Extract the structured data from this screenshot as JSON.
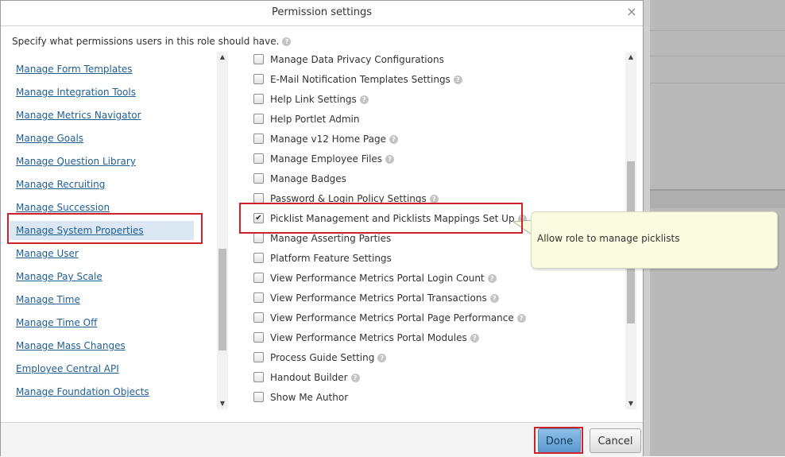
{
  "dialog": {
    "title": "Permission settings",
    "close_symbol": "×",
    "instruction": "Specify what permissions users in this role should have."
  },
  "left_nav": {
    "items": [
      {
        "label": "Manage Form Templates",
        "selected": false
      },
      {
        "label": "Manage Integration Tools",
        "selected": false
      },
      {
        "label": "Manage Metrics Navigator",
        "selected": false
      },
      {
        "label": "Manage Goals",
        "selected": false
      },
      {
        "label": "Manage Question Library",
        "selected": false
      },
      {
        "label": "Manage Recruiting",
        "selected": false
      },
      {
        "label": "Manage Succession",
        "selected": false
      },
      {
        "label": "Manage System Properties",
        "selected": true
      },
      {
        "label": "Manage User",
        "selected": false
      },
      {
        "label": "Manage Pay Scale",
        "selected": false
      },
      {
        "label": "Manage Time",
        "selected": false
      },
      {
        "label": "Manage Time Off",
        "selected": false
      },
      {
        "label": "Manage Mass Changes",
        "selected": false
      },
      {
        "label": "Employee Central API",
        "selected": false
      },
      {
        "label": "Manage Foundation Objects",
        "selected": false
      }
    ]
  },
  "permissions": {
    "items": [
      {
        "label": "Manage Data Privacy Configurations",
        "checked": false,
        "help": false
      },
      {
        "label": "E-Mail Notification Templates Settings",
        "checked": false,
        "help": true
      },
      {
        "label": "Help Link Settings",
        "checked": false,
        "help": true
      },
      {
        "label": "Help Portlet Admin",
        "checked": false,
        "help": false
      },
      {
        "label": "Manage v12 Home Page",
        "checked": false,
        "help": true
      },
      {
        "label": "Manage Employee Files",
        "checked": false,
        "help": true
      },
      {
        "label": "Manage Badges",
        "checked": false,
        "help": false
      },
      {
        "label": "Password & Login Policy Settings",
        "checked": false,
        "help": true
      },
      {
        "label": "Picklist Management and Picklists Mappings Set Up",
        "checked": true,
        "help": true
      },
      {
        "label": "Manage Asserting Parties",
        "checked": false,
        "help": false
      },
      {
        "label": "Platform Feature Settings",
        "checked": false,
        "help": false
      },
      {
        "label": "View Performance Metrics Portal Login Count",
        "checked": false,
        "help": true
      },
      {
        "label": "View Performance Metrics Portal Transactions",
        "checked": false,
        "help": true
      },
      {
        "label": "View Performance Metrics Portal Page Performance",
        "checked": false,
        "help": true
      },
      {
        "label": "View Performance Metrics Portal Modules",
        "checked": false,
        "help": true
      },
      {
        "label": "Process Guide Setting",
        "checked": false,
        "help": true
      },
      {
        "label": "Handout Builder",
        "checked": false,
        "help": true
      },
      {
        "label": "Show Me Author",
        "checked": false,
        "help": false
      }
    ]
  },
  "tooltip": {
    "text": "Allow role to manage picklists"
  },
  "footer": {
    "done_label": "Done",
    "cancel_label": "Cancel"
  },
  "icons": {
    "help_icon": "?",
    "check_mark": "✔",
    "scroll_up": "▲",
    "scroll_down": "▼"
  },
  "colors": {
    "link": "#1f5e93",
    "selected_bg": "#dbe7f3",
    "highlight_border": "#d0202a",
    "tooltip_bg": "#fbfbe0",
    "done_button": "#6ea8da"
  }
}
